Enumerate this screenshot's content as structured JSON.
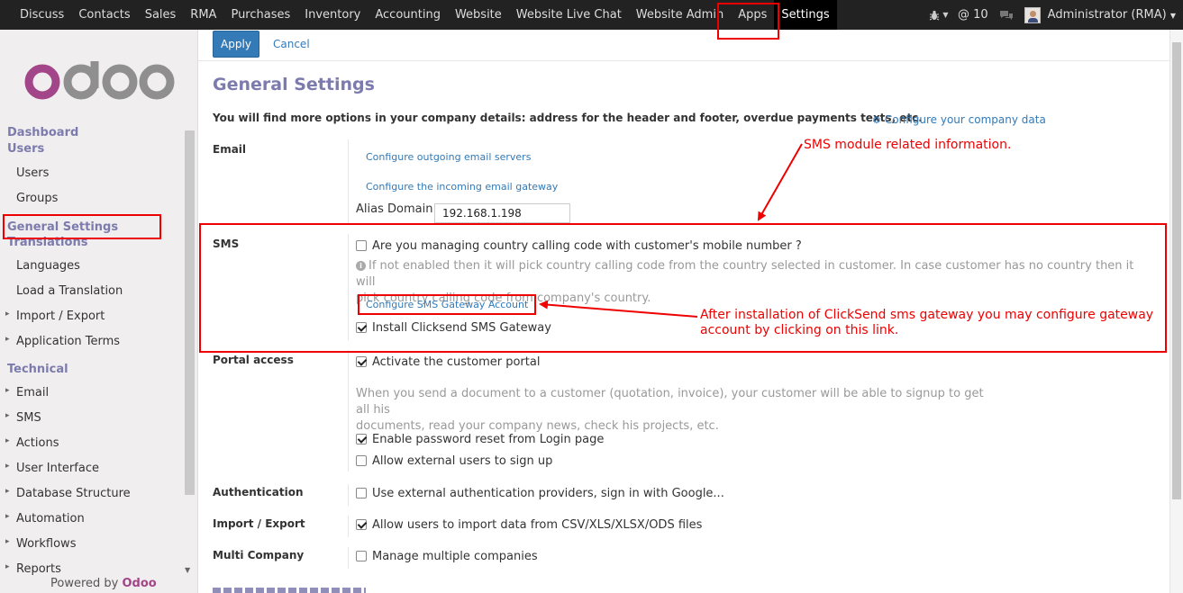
{
  "topnav": {
    "items": [
      "Discuss",
      "Contacts",
      "Sales",
      "RMA",
      "Purchases",
      "Inventory",
      "Accounting",
      "Website",
      "Website Live Chat",
      "Website Admin",
      "Apps",
      "Settings"
    ],
    "active": "Settings",
    "mentions_count": "@ 10",
    "user": "Administrator (RMA)"
  },
  "sidebar": {
    "logo_text": "odoo",
    "dashboard": "Dashboard",
    "users_section": "Users",
    "users_items": [
      "Users",
      "Groups"
    ],
    "general_settings": "General Settings",
    "translations_section": "Translations",
    "translations_items": [
      "Languages",
      "Load a Translation",
      "Import / Export",
      "Application Terms"
    ],
    "technical_section": "Technical",
    "technical_items": [
      "Email",
      "SMS",
      "Actions",
      "User Interface",
      "Database Structure",
      "Automation",
      "Workflows",
      "Reports"
    ],
    "powered_prefix": "Powered by",
    "powered_brand": "Odoo"
  },
  "toolbar": {
    "apply": "Apply",
    "cancel": "Cancel"
  },
  "main": {
    "title": "General Settings",
    "intro": "You will find more options in your company details: address for the header and footer, overdue payments texts, etc.",
    "company_link": "Configure your company data",
    "email": {
      "label": "Email",
      "outgoing_link": "Configure outgoing email servers",
      "incoming_link": "Configure the incoming email gateway",
      "alias_label": "Alias Domain",
      "alias_value": "192.168.1.198"
    },
    "sms": {
      "label": "SMS",
      "country_code_option": "Are you managing country calling code with customer's mobile number ?",
      "help_line1": "If not enabled then it will pick country calling code from the country selected in customer. In case customer has no country then it will",
      "help_line2": "pick country calling code from company's country.",
      "gateway_link": "Configure SMS Gateway Account",
      "clicksend_option": "Install Clicksend SMS Gateway"
    },
    "portal": {
      "label": "Portal access",
      "activate_option": "Activate the customer portal",
      "help_line1": "When you send a document to a customer (quotation, invoice), your customer will be able to signup to get all his",
      "help_line2": "documents, read your company news, check his projects, etc.",
      "password_reset_option": "Enable password reset from Login page",
      "external_signup_option": "Allow external users to sign up"
    },
    "authentication": {
      "label": "Authentication",
      "option": "Use external authentication providers, sign in with Google..."
    },
    "import_export": {
      "label": "Import / Export",
      "option": "Allow users to import data from CSV/XLS/XLSX/ODS files"
    },
    "multi_company": {
      "label": "Multi Company",
      "option": "Manage multiple companies"
    }
  },
  "annotations": {
    "sms_info": "SMS module related information.",
    "gateway_line1": "After installation of ClickSend sms gateway you may configure gateway",
    "gateway_line2": "account by clicking on this link."
  },
  "colors": {
    "topbar": "#222222",
    "accent": "#7c7bad",
    "link": "#337ab7",
    "annotation": "#ee0000"
  }
}
